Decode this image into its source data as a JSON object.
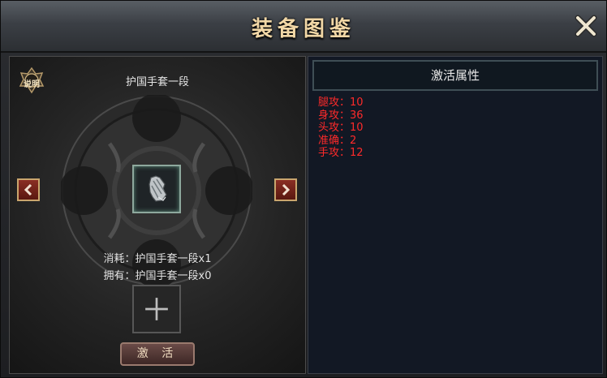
{
  "window": {
    "title": "装备图鉴",
    "close_icon": "close-x-icon"
  },
  "left_panel": {
    "help_label": "说明",
    "item_name": "护国手套一段",
    "item_icon": "glove-icon",
    "cost_text": "消耗：护国手套一段x1",
    "own_text": "拥有：护国手套一段x0",
    "add_icon": "plus-icon",
    "activate_label": "激 活",
    "prev_icon": "chevron-left-icon",
    "next_icon": "chevron-right-icon"
  },
  "right_panel": {
    "header": "激活属性",
    "attributes": [
      "腿攻：10",
      "身攻：36",
      "头攻：10",
      "准确：2",
      "手攻：12"
    ],
    "attribute_color": "#ff2a2a"
  }
}
